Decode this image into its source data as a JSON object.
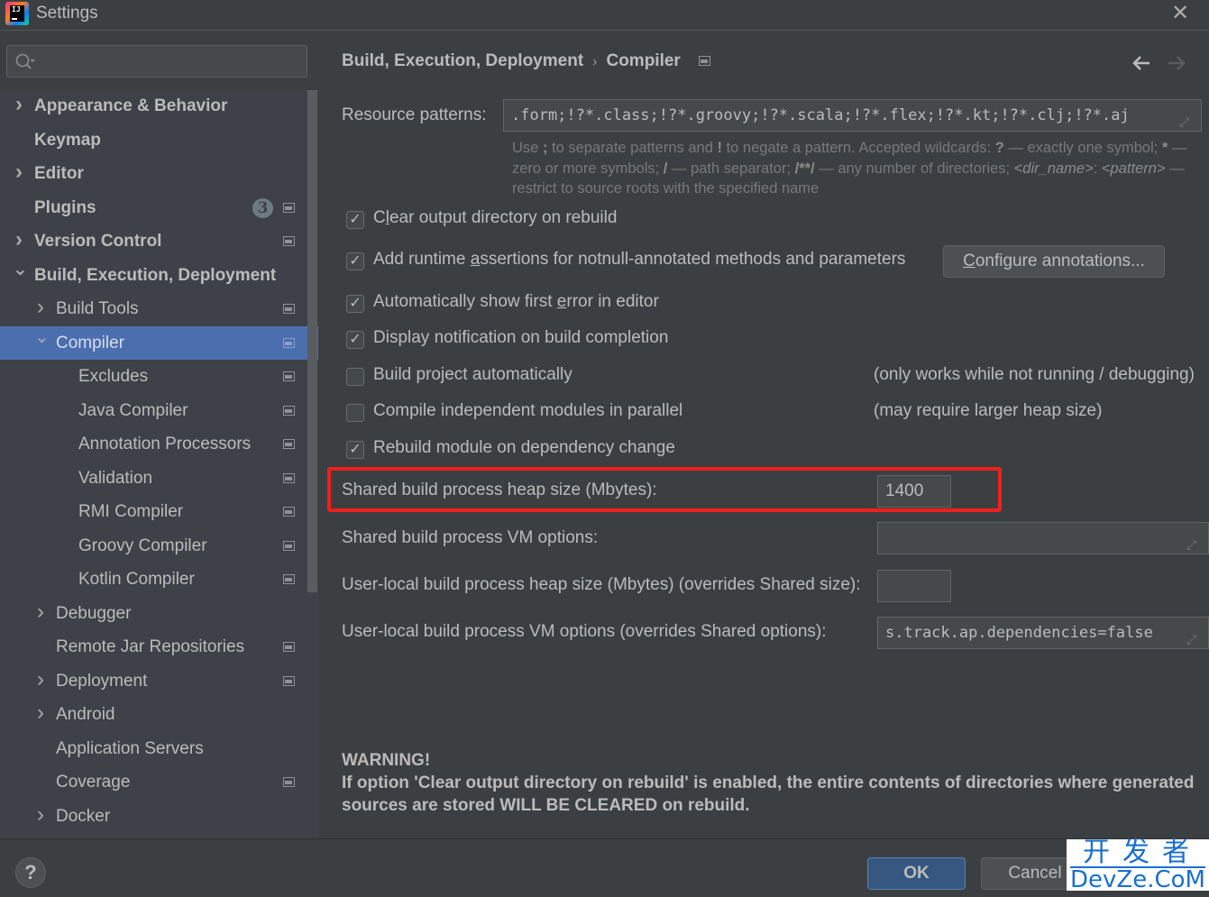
{
  "window": {
    "title": "Settings",
    "close_glyph": "✕",
    "logo_text": "IJ"
  },
  "search": {
    "value": "",
    "placeholder": ""
  },
  "sidebar": {
    "items": [
      {
        "label": "Appearance & Behavior",
        "level": 0,
        "bold": true,
        "chevron": "right",
        "project_icon": false
      },
      {
        "label": "Keymap",
        "level": 0,
        "bold": true,
        "chevron": null,
        "project_icon": false
      },
      {
        "label": "Editor",
        "level": 0,
        "bold": true,
        "chevron": "right",
        "project_icon": false
      },
      {
        "label": "Plugins",
        "level": 0,
        "bold": true,
        "chevron": null,
        "project_icon": true,
        "badge": "3"
      },
      {
        "label": "Version Control",
        "level": 0,
        "bold": true,
        "chevron": "right",
        "project_icon": true
      },
      {
        "label": "Build, Execution, Deployment",
        "level": 0,
        "bold": true,
        "chevron": "down",
        "project_icon": false
      },
      {
        "label": "Build Tools",
        "level": 1,
        "bold": false,
        "chevron": "right",
        "project_icon": true
      },
      {
        "label": "Compiler",
        "level": 1,
        "bold": false,
        "chevron": "down",
        "project_icon": true,
        "selected": true
      },
      {
        "label": "Excludes",
        "level": 2,
        "bold": false,
        "chevron": null,
        "project_icon": true
      },
      {
        "label": "Java Compiler",
        "level": 2,
        "bold": false,
        "chevron": null,
        "project_icon": true
      },
      {
        "label": "Annotation Processors",
        "level": 2,
        "bold": false,
        "chevron": null,
        "project_icon": true
      },
      {
        "label": "Validation",
        "level": 2,
        "bold": false,
        "chevron": null,
        "project_icon": true
      },
      {
        "label": "RMI Compiler",
        "level": 2,
        "bold": false,
        "chevron": null,
        "project_icon": true
      },
      {
        "label": "Groovy Compiler",
        "level": 2,
        "bold": false,
        "chevron": null,
        "project_icon": true
      },
      {
        "label": "Kotlin Compiler",
        "level": 2,
        "bold": false,
        "chevron": null,
        "project_icon": true
      },
      {
        "label": "Debugger",
        "level": 1,
        "bold": false,
        "chevron": "right",
        "project_icon": false
      },
      {
        "label": "Remote Jar Repositories",
        "level": 1,
        "bold": false,
        "chevron": null,
        "project_icon": true
      },
      {
        "label": "Deployment",
        "level": 1,
        "bold": false,
        "chevron": "right",
        "project_icon": true
      },
      {
        "label": "Android",
        "level": 1,
        "bold": false,
        "chevron": "right",
        "project_icon": false
      },
      {
        "label": "Application Servers",
        "level": 1,
        "bold": false,
        "chevron": null,
        "project_icon": false
      },
      {
        "label": "Coverage",
        "level": 1,
        "bold": false,
        "chevron": null,
        "project_icon": true
      },
      {
        "label": "Docker",
        "level": 1,
        "bold": false,
        "chevron": "right",
        "project_icon": false
      }
    ]
  },
  "breadcrumb": {
    "parent": "Build, Execution, Deployment",
    "separator": "›",
    "current": "Compiler",
    "back_glyph": "🡐",
    "forward_glyph": "🡒"
  },
  "resource_patterns": {
    "label": "Resource patterns:",
    "value": ".form;!?*.class;!?*.groovy;!?*.scala;!?*.flex;!?*.kt;!?*.clj;!?*.aj",
    "hint_parts": {
      "p1": "Use ",
      "b1": ";",
      "p2": " to separate patterns and ",
      "b2": "!",
      "p3": " to negate a pattern. Accepted wildcards: ",
      "b3": "?",
      "p4": " — exactly one symbol; ",
      "b4": "*",
      "p5": " — zero or more symbols; ",
      "b5": "/",
      "p6": " — path separator; ",
      "b6": "/**/",
      "p7": " — any number of directories; ",
      "i1": "<dir_name>",
      "p8": ": ",
      "i2": "<pattern>",
      "p9": " — restrict to source roots with the specified name"
    }
  },
  "options": [
    {
      "pre": "C",
      "mn": "l",
      "post": "ear output directory on rebuild",
      "checked": true
    },
    {
      "pre": "Add runtime ",
      "mn": "a",
      "post": "ssertions for notnull-annotated methods and parameters",
      "checked": true
    },
    {
      "pre": "Automatically show first ",
      "mn": "e",
      "post": "rror in editor",
      "checked": true
    },
    {
      "pre": "Display notification on build completion",
      "mn": "",
      "post": "",
      "checked": true
    },
    {
      "pre": "Build project automatically",
      "mn": "",
      "post": "",
      "checked": false,
      "note": "(only works while not running / debugging)"
    },
    {
      "pre": "Compile independent modules in parallel",
      "mn": "",
      "post": "",
      "checked": false,
      "note": "(may require larger heap size)"
    },
    {
      "pre": "Rebuild module on dependency change",
      "mn": "",
      "post": "",
      "checked": true
    }
  ],
  "configure_annotations": {
    "mn": "C",
    "rest": "onfigure annotations..."
  },
  "check_glyph": "✓",
  "heap": {
    "shared_heap_label": "Shared build process heap size (Mbytes):",
    "shared_heap_value": "1400",
    "shared_vm_label": "Shared build process VM options:",
    "shared_vm_value": "",
    "user_heap_label": "User-local build process heap size (Mbytes) (overrides Shared size):",
    "user_heap_value": "",
    "user_vm_label": "User-local build process VM options (overrides Shared options):",
    "user_vm_value": "s.track.ap.dependencies=false"
  },
  "warning": {
    "title": "WARNING!",
    "body": "If option 'Clear output directory on rebuild' is enabled, the entire contents of directories where generated sources are stored WILL BE CLEARED on rebuild."
  },
  "footer": {
    "help": "?",
    "ok": "OK",
    "cancel": "Cancel"
  },
  "watermark": {
    "line1": "开发者",
    "line2": "DevZe.CoM"
  },
  "colors": {
    "selection": "#4b6eaf",
    "highlight_box": "#f0201c",
    "ok_button": "#365880",
    "watermark": "#1a6fce"
  }
}
